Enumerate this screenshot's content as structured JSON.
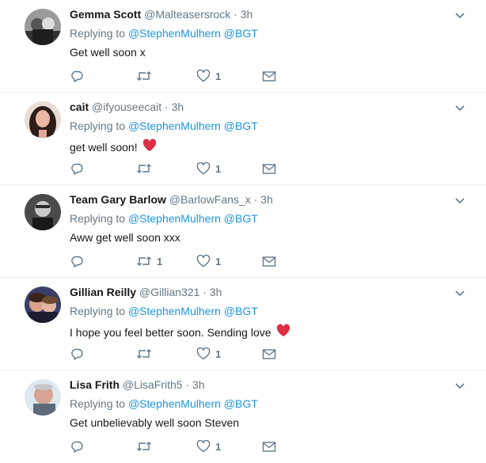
{
  "tweets": [
    {
      "name": "Gemma Scott",
      "handle": "@Malteasersrock",
      "time": "3h",
      "reply_prefix": "Replying to",
      "reply_to": "@StephenMulhern @BGT",
      "text": "Get well soon x",
      "emoji": "",
      "retweets": "",
      "likes": "1"
    },
    {
      "name": "cait",
      "handle": "@ifyouseecait",
      "time": "3h",
      "reply_prefix": "Replying to",
      "reply_to": "@StephenMulhern @BGT",
      "text": "get well soon!",
      "emoji": "red-heart",
      "retweets": "",
      "likes": "1"
    },
    {
      "name": "Team Gary Barlow",
      "handle": "@BarlowFans_x",
      "time": "3h",
      "reply_prefix": "Replying to",
      "reply_to": "@StephenMulhern @BGT",
      "text": "Aww get well soon xxx",
      "emoji": "",
      "retweets": "1",
      "likes": "1"
    },
    {
      "name": "Gillian Reilly",
      "handle": "@Gillian321",
      "time": "3h",
      "reply_prefix": "Replying to",
      "reply_to": "@StephenMulhern @BGT",
      "text": "I hope you feel better soon. Sending love",
      "emoji": "red-heart",
      "retweets": "",
      "likes": "1"
    },
    {
      "name": "Lisa Frith",
      "handle": "@LisaFrith5",
      "time": "3h",
      "reply_prefix": "Replying to",
      "reply_to": "@StephenMulhern @BGT",
      "text": "Get unbelievably well soon Steven",
      "emoji": "",
      "retweets": "",
      "likes": "1"
    }
  ],
  "colors": {
    "link": "#1b95e0",
    "muted": "#657786",
    "heart": "#e0245e"
  }
}
